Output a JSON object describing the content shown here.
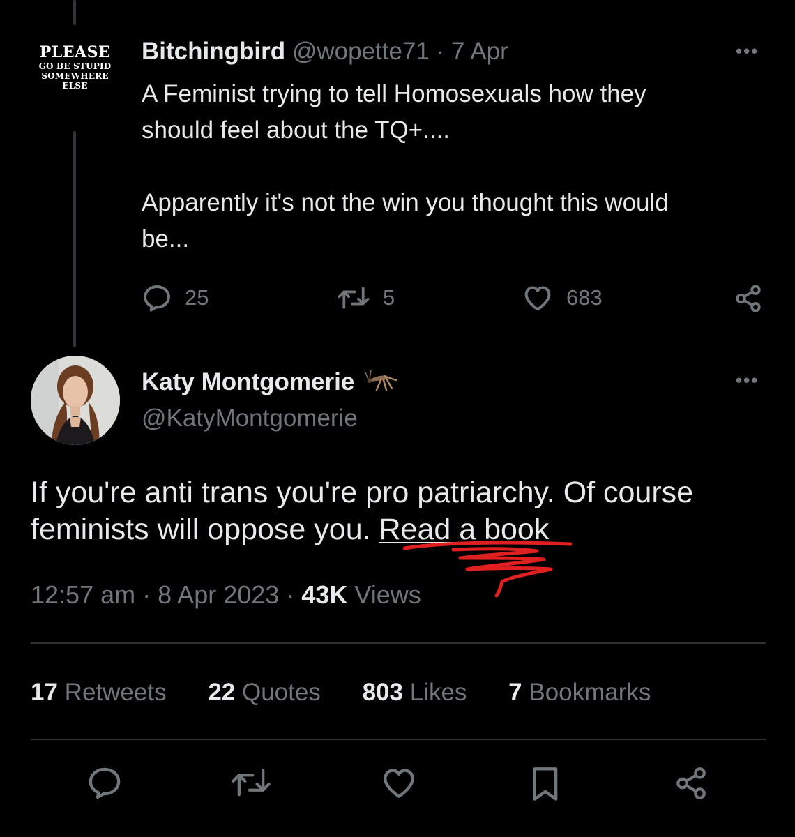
{
  "quoted_tweet": {
    "avatar_text": {
      "line1": "PLEASE",
      "line2": "GO BE STUPID",
      "line3": "SOMEWHERE",
      "line4": "ELSE"
    },
    "display_name": "Bitchingbird",
    "handle": "@wopette71",
    "separator": "·",
    "date": "7 Apr",
    "more_icon": "more-dots-icon",
    "text_lines": [
      "A Feminist trying to tell Homosexuals how they",
      "should feel about the TQ+....",
      "",
      "Apparently it's not the win you thought this would",
      "be..."
    ],
    "actions": {
      "reply_count": "25",
      "retweet_count": "5",
      "like_count": "683"
    }
  },
  "main_tweet": {
    "display_name": "Katy Montgomerie",
    "handle": "@KatyMontgomerie",
    "text_plain": "If you're anti trans you're pro patriarchy. Of course feminists will oppose you. ",
    "text_link": "Read a book",
    "time": "12:57 am",
    "separator": "·",
    "date": "8 Apr 2023",
    "views_count": "43K",
    "views_label": "Views"
  },
  "stats": [
    {
      "count": "17",
      "label": "Retweets"
    },
    {
      "count": "22",
      "label": "Quotes"
    },
    {
      "count": "803",
      "label": "Likes"
    },
    {
      "count": "7",
      "label": "Bookmarks"
    }
  ],
  "bottom_actions": [
    "reply-icon",
    "retweet-icon",
    "like-icon",
    "bookmark-icon",
    "share-icon"
  ],
  "colors": {
    "background": "#000000",
    "text": "#e7e9ea",
    "secondary": "#71767b",
    "annotation": "#e02020"
  }
}
